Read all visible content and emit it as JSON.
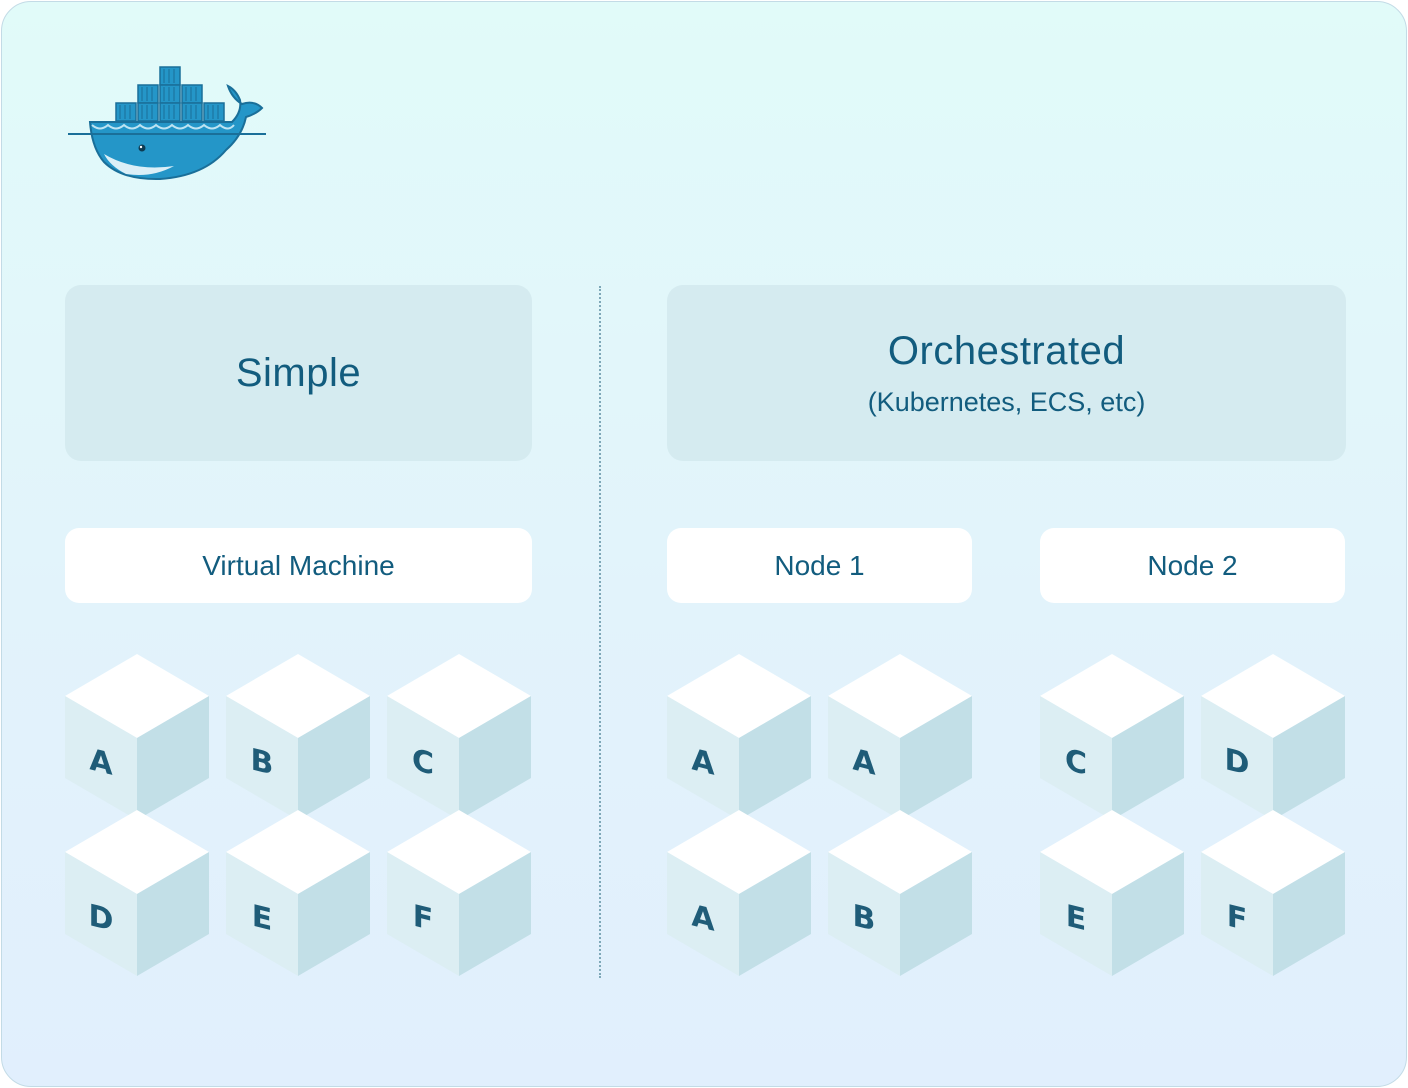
{
  "logo": {
    "icon": "docker-whale-icon"
  },
  "simple": {
    "title": "Simple",
    "machine_label": "Virtual Machine",
    "containers": [
      "A",
      "B",
      "C",
      "D",
      "E",
      "F"
    ]
  },
  "orchestrated": {
    "title": "Orchestrated",
    "subtitle": "(Kubernetes, ECS, etc)",
    "nodes": [
      {
        "label": "Node 1",
        "containers": [
          "A",
          "A",
          "A",
          "B"
        ]
      },
      {
        "label": "Node 2",
        "containers": [
          "C",
          "D",
          "E",
          "F"
        ]
      }
    ]
  },
  "colors": {
    "text": "#125c7e",
    "panel": "#d5ebf0",
    "cube_top": "#ffffff",
    "cube_left": "#dceef3",
    "cube_right": "#c2dfe7",
    "docker_blue": "#2496c8"
  }
}
